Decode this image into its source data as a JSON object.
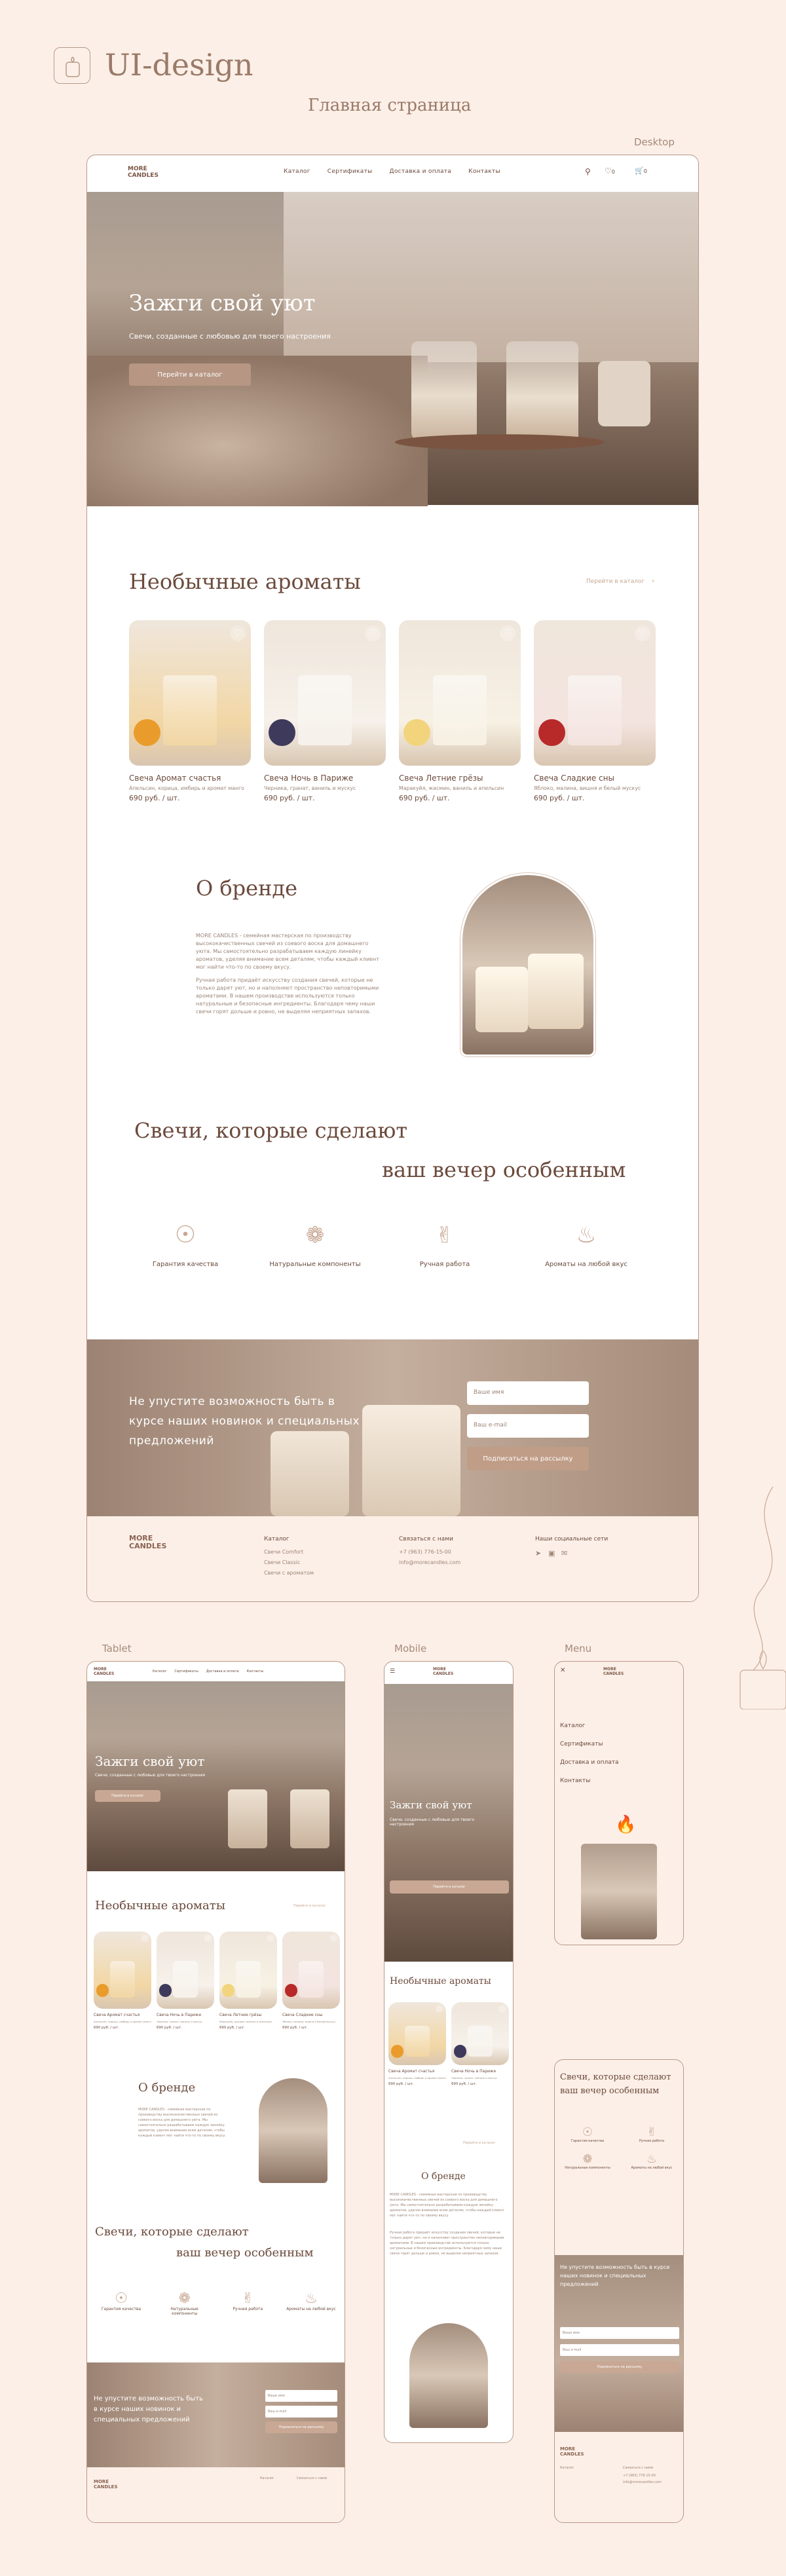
{
  "header": {
    "title": "UI-design",
    "subtitle": "Главная страница",
    "label_desktop": "Desktop",
    "label_tablet": "Tablet",
    "label_mobile": "Mobile",
    "label_menu": "Menu"
  },
  "brand": {
    "logo": "MORE CANDLES"
  },
  "nav": {
    "items": [
      "Каталог",
      "Сертификаты",
      "Доставка и оплата",
      "Контакты"
    ],
    "cart": "0",
    "fav": "0"
  },
  "hero": {
    "title": "Зажги свой уют",
    "subtitle": "Свечи, созданные с любовью для твоего настроения",
    "button": "Перейти в каталог"
  },
  "aromas": {
    "title": "Необычные ароматы",
    "link": "Перейти в каталог",
    "products": [
      {
        "name": "Свеча Аромат счастья",
        "desc": "Апельсин, корица, имбирь и аромат манго",
        "price": "690 руб. / шт."
      },
      {
        "name": "Свеча Ночь в Париже",
        "desc": "Черника, гранат, ваниль и мускус",
        "price": "690 руб. / шт."
      },
      {
        "name": "Свеча Летние грёзы",
        "desc": "Маракуйя, жасмин, ваниль и апельсин",
        "price": "690 руб. / шт."
      },
      {
        "name": "Свеча Сладкие сны",
        "desc": "Яблоко, малина, вишня и белый мускус",
        "price": "690 руб. / шт."
      }
    ]
  },
  "about": {
    "title": "О бренде",
    "p1": "MORE CANDLES - семейная мастерская по производству высококачественных свечей из соевого воска для домашнего уюта. Мы самостоятельно разрабатываем каждую линейку ароматов, уделяя внимание всем деталям, чтобы каждый клиент мог найти что-то по своему вкусу.",
    "p2": "Ручная работа придаёт искусству создания свечей, которые не только дарят уют, но и наполняют пространство неповторимыми ароматами. В нашем производстве используются только натуральные и безопасные ингредиенты. Благодаря чему наши свечи горят дольше и ровно, не выделяя неприятных запахов."
  },
  "tagline": {
    "line1": "Свечи, которые сделают",
    "line2": "ваш вечер особенным"
  },
  "features": [
    "Гарантия качества",
    "Натуральные компоненты",
    "Ручная работа",
    "Ароматы на любой вкус"
  ],
  "subscribe": {
    "text": "Не упустите возможность быть в курсе наших новинок и специальных предложений",
    "name_ph": "Ваше имя",
    "email_ph": "Ваш e-mail",
    "button": "Подписаться на рассылку"
  },
  "footer": {
    "catalog_title": "Каталог",
    "catalog": [
      "Свечи Comfort",
      "Свечи Classic",
      "Свечи с ароматом"
    ],
    "contact_title": "Связаться с нами",
    "phone": "+7 (963) 776-15-00",
    "email": "info@morecandles.com",
    "social_title": "Наши социальные сети"
  },
  "colors": {
    "bg": "#fcefe7",
    "accent": "#c8a894",
    "text": "#6b4a3c"
  }
}
